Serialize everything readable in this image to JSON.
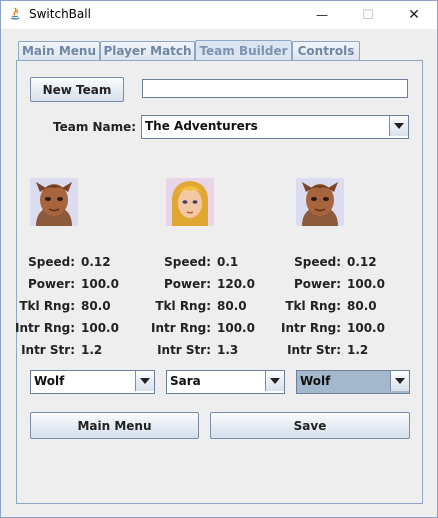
{
  "window": {
    "title": "SwitchBall",
    "minimize_glyph": "—",
    "maximize_glyph": "☐",
    "close_glyph": "✕"
  },
  "tabs": [
    {
      "label": "Main Menu",
      "active": false
    },
    {
      "label": "Player Match",
      "active": false
    },
    {
      "label": "Team Builder",
      "active": true
    },
    {
      "label": "Controls",
      "active": false
    }
  ],
  "team_builder": {
    "new_team_label": "New Team",
    "new_team_input_value": "",
    "team_name_label": "Team Name:",
    "team_name_selected": "The Adventurers",
    "stat_labels": {
      "speed": "Speed:",
      "power": "Power:",
      "tkl_rng": "Tkl Rng:",
      "intr_rng": "Intr Rng:",
      "intr_str": "Intr Str:"
    },
    "players": [
      {
        "portrait": "wolf-portrait",
        "speed": "0.12",
        "power": "100.0",
        "tkl_rng": "80.0",
        "intr_rng": "100.0",
        "intr_str": "1.2",
        "selected": "Wolf"
      },
      {
        "portrait": "sara-portrait",
        "speed": "0.1",
        "power": "120.0",
        "tkl_rng": "80.0",
        "intr_rng": "100.0",
        "intr_str": "1.3",
        "selected": "Sara"
      },
      {
        "portrait": "wolf-portrait",
        "speed": "0.12",
        "power": "100.0",
        "tkl_rng": "80.0",
        "intr_rng": "100.0",
        "intr_str": "1.2",
        "selected": "Wolf"
      }
    ],
    "main_menu_label": "Main Menu",
    "save_label": "Save"
  },
  "colors": {
    "tab_text": "#6f86a5",
    "border": "#8ea7c4",
    "selected_combo": "#a3b8cc"
  }
}
